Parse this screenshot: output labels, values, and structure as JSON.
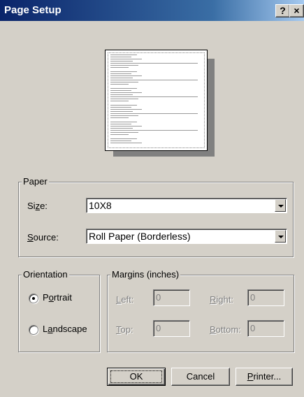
{
  "window": {
    "title": "Page Setup"
  },
  "titlebar": {
    "help": "?",
    "close": "×"
  },
  "paper": {
    "legend": "Paper",
    "size_label": "Size:",
    "size_value": "10X8",
    "source_label": "Source:",
    "source_value": "Roll Paper (Borderless)"
  },
  "orientation": {
    "legend": "Orientation",
    "portrait": "Portrait",
    "landscape": "Landscape",
    "selected": "portrait"
  },
  "margins": {
    "legend": "Margins (inches)",
    "left_label": "Left:",
    "left_value": "0",
    "right_label": "Right:",
    "right_value": "0",
    "top_label": "Top:",
    "top_value": "0",
    "bottom_label": "Bottom:",
    "bottom_value": "0"
  },
  "buttons": {
    "ok": "OK",
    "cancel": "Cancel",
    "printer": "Printer..."
  }
}
